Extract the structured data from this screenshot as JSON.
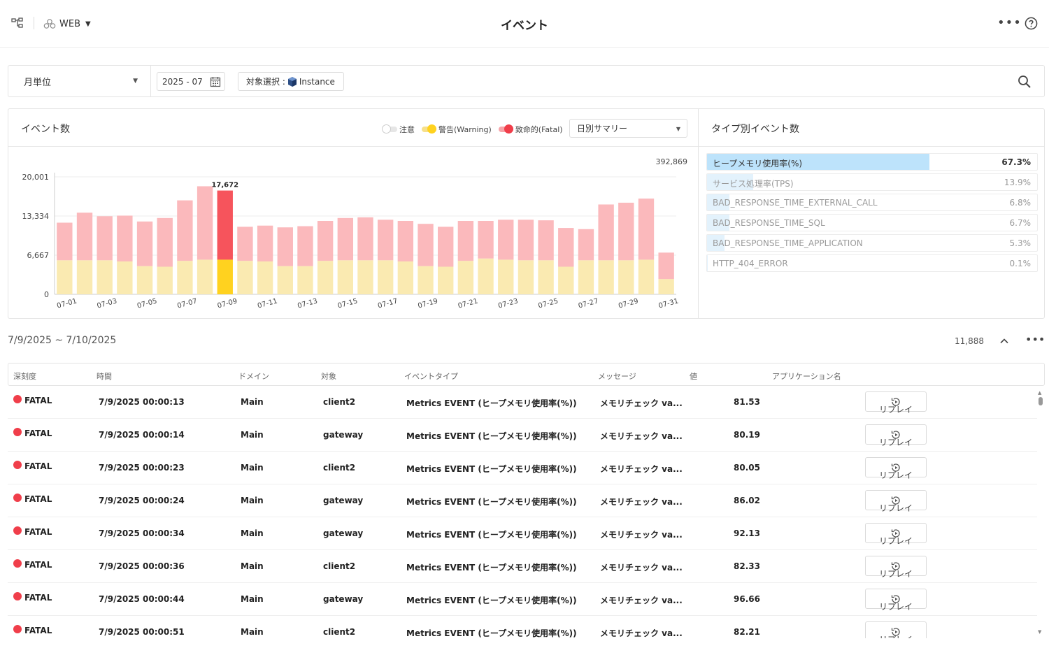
{
  "header": {
    "app_name": "WEB",
    "title": "イベント"
  },
  "filters": {
    "period": "月単位",
    "month": "2025 - 07",
    "target_label": "対象選択 :",
    "target_value": "Instance"
  },
  "event_panel": {
    "title": "イベント数",
    "legend": [
      {
        "label": "注意",
        "color": "#d9d9d9"
      },
      {
        "label": "警告(Warning)",
        "color": "#ffd21f"
      },
      {
        "label": "致命的(Fatal)",
        "color": "#f03e4a"
      }
    ],
    "summary_select": "日別サマリー",
    "total": "392,869"
  },
  "chart_data": {
    "type": "bar",
    "stacked": true,
    "categories": [
      "07-01",
      "07-02",
      "07-03",
      "07-04",
      "07-05",
      "07-06",
      "07-07",
      "07-08",
      "07-09",
      "07-10",
      "07-11",
      "07-12",
      "07-13",
      "07-14",
      "07-15",
      "07-16",
      "07-17",
      "07-18",
      "07-19",
      "07-20",
      "07-21",
      "07-22",
      "07-23",
      "07-24",
      "07-25",
      "07-26",
      "07-27",
      "07-28",
      "07-29",
      "07-30",
      "07-31"
    ],
    "x_tick_labels": [
      "07-01",
      "07-03",
      "07-05",
      "07-07",
      "07-09",
      "07-11",
      "07-13",
      "07-15",
      "07-17",
      "07-19",
      "07-21",
      "07-23",
      "07-25",
      "07-27",
      "07-29",
      "07-31"
    ],
    "series": [
      {
        "name": "警告(Warning)",
        "color": "#faeab1",
        "highlight_color": "#ffd21f",
        "values": [
          5800,
          5800,
          5800,
          5600,
          4800,
          4700,
          5700,
          5900,
          5900,
          5700,
          5600,
          4800,
          4800,
          5700,
          5800,
          5800,
          5800,
          5600,
          4800,
          4700,
          5700,
          6100,
          5900,
          5800,
          5800,
          4700,
          5800,
          5800,
          5800,
          5900,
          2600
        ]
      },
      {
        "name": "致命的(Fatal)",
        "color": "#fbb9bc",
        "highlight_color": "#f6545c",
        "values": [
          6400,
          8100,
          7500,
          7800,
          7600,
          8300,
          10300,
          12500,
          11772,
          5800,
          6100,
          6600,
          6800,
          6800,
          7200,
          7300,
          6900,
          6900,
          7200,
          6800,
          6800,
          6400,
          6800,
          6900,
          6800,
          6600,
          5300,
          9500,
          9800,
          10400,
          4500
        ]
      }
    ],
    "highlight_index": 8,
    "highlight_label": "17,672",
    "y_ticks": [
      "0",
      "6,667",
      "13,334",
      "20,001"
    ],
    "ylim": [
      0,
      20001
    ]
  },
  "type_panel": {
    "title": "タイプ別イベント数",
    "items": [
      {
        "name": "ヒープメモリ使用率(%)",
        "pct": "67.3%",
        "value": 0.673
      },
      {
        "name": "サービス処理率(TPS)",
        "pct": "13.9%",
        "value": 0.139
      },
      {
        "name": "BAD_RESPONSE_TIME_EXTERNAL_CALL",
        "pct": "6.8%",
        "value": 0.068
      },
      {
        "name": "BAD_RESPONSE_TIME_SQL",
        "pct": "6.7%",
        "value": 0.067
      },
      {
        "name": "BAD_RESPONSE_TIME_APPLICATION",
        "pct": "5.3%",
        "value": 0.053
      },
      {
        "name": "HTTP_404_ERROR",
        "pct": "0.1%",
        "value": 0.001
      }
    ]
  },
  "list": {
    "range": "7/9/2025 ~ 7/10/2025",
    "count": "11,888",
    "columns": [
      "深刻度",
      "時間",
      "ドメイン",
      "対象",
      "イベントタイプ",
      "メッセージ",
      "値",
      "アプリケーション名"
    ],
    "replay_label": "リプレイ",
    "rows": [
      {
        "severity": "FATAL",
        "time": "7/9/2025 00:00:13",
        "domain": "Main",
        "target": "client2",
        "type": "Metrics EVENT (ヒープメモリ使用率(%))",
        "message": "メモリチェック va...",
        "value": "81.53"
      },
      {
        "severity": "FATAL",
        "time": "7/9/2025 00:00:14",
        "domain": "Main",
        "target": "gateway",
        "type": "Metrics EVENT (ヒープメモリ使用率(%))",
        "message": "メモリチェック va...",
        "value": "80.19"
      },
      {
        "severity": "FATAL",
        "time": "7/9/2025 00:00:23",
        "domain": "Main",
        "target": "client2",
        "type": "Metrics EVENT (ヒープメモリ使用率(%))",
        "message": "メモリチェック va...",
        "value": "80.05"
      },
      {
        "severity": "FATAL",
        "time": "7/9/2025 00:00:24",
        "domain": "Main",
        "target": "gateway",
        "type": "Metrics EVENT (ヒープメモリ使用率(%))",
        "message": "メモリチェック va...",
        "value": "86.02"
      },
      {
        "severity": "FATAL",
        "time": "7/9/2025 00:00:34",
        "domain": "Main",
        "target": "gateway",
        "type": "Metrics EVENT (ヒープメモリ使用率(%))",
        "message": "メモリチェック va...",
        "value": "92.13"
      },
      {
        "severity": "FATAL",
        "time": "7/9/2025 00:00:36",
        "domain": "Main",
        "target": "client2",
        "type": "Metrics EVENT (ヒープメモリ使用率(%))",
        "message": "メモリチェック va...",
        "value": "82.33"
      },
      {
        "severity": "FATAL",
        "time": "7/9/2025 00:00:44",
        "domain": "Main",
        "target": "gateway",
        "type": "Metrics EVENT (ヒープメモリ使用率(%))",
        "message": "メモリチェック va...",
        "value": "96.66"
      },
      {
        "severity": "FATAL",
        "time": "7/9/2025 00:00:51",
        "domain": "Main",
        "target": "client2",
        "type": "Metrics EVENT (ヒープメモリ使用率(%))",
        "message": "メモリチェック va...",
        "value": "82.21"
      }
    ]
  }
}
